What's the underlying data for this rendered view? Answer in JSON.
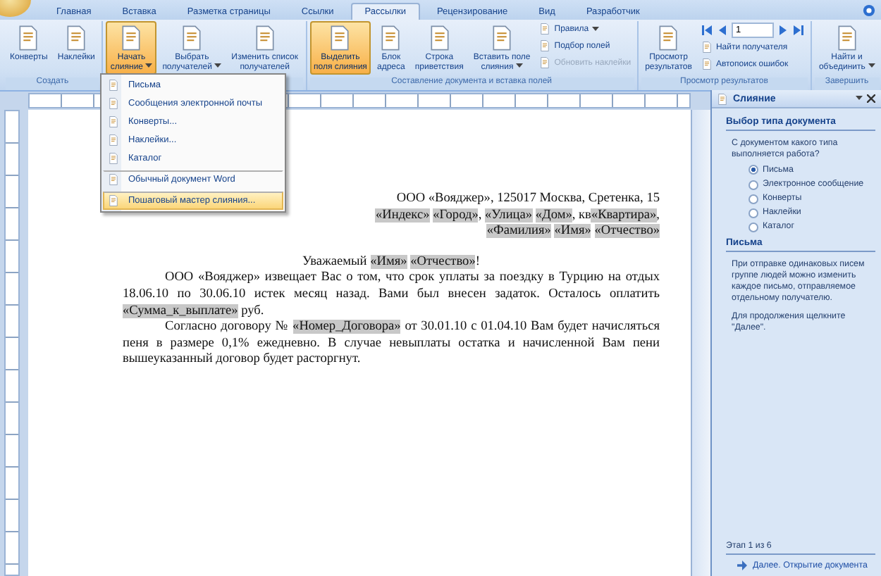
{
  "tabs": [
    {
      "label": "Главная",
      "selected": false
    },
    {
      "label": "Вставка",
      "selected": false
    },
    {
      "label": "Разметка страницы",
      "selected": false
    },
    {
      "label": "Ссылки",
      "selected": false
    },
    {
      "label": "Рассылки",
      "selected": true
    },
    {
      "label": "Рецензирование",
      "selected": false
    },
    {
      "label": "Вид",
      "selected": false
    },
    {
      "label": "Разработчик",
      "selected": false
    }
  ],
  "ribbon": {
    "groups": [
      {
        "label": "Создать",
        "columns": [
          [
            {
              "kind": "large",
              "label": "Конверты",
              "active": false,
              "disabled": false,
              "dropdown": false
            }
          ],
          [
            {
              "kind": "large",
              "label": "Наклейки",
              "active": false,
              "disabled": false,
              "dropdown": false
            }
          ]
        ]
      },
      {
        "columns": [
          [
            {
              "kind": "large",
              "label": "Начать\nслияние",
              "active": true,
              "disabled": false,
              "dropdown": true
            }
          ],
          [
            {
              "kind": "large",
              "label": "Выбрать\nполучателей",
              "active": false,
              "disabled": false,
              "dropdown": true
            }
          ],
          [
            {
              "kind": "large",
              "label": "Изменить список\nполучателей",
              "active": false,
              "disabled": false,
              "dropdown": false
            }
          ]
        ]
      },
      {
        "label": "Составление документа и вставка полей",
        "columns": [
          [
            {
              "kind": "large",
              "label": "Выделить\nполя слияния",
              "active": true,
              "disabled": false,
              "dropdown": false
            }
          ],
          [
            {
              "kind": "large",
              "label": "Блок\nадреса",
              "active": false,
              "disabled": false,
              "dropdown": false
            }
          ],
          [
            {
              "kind": "large",
              "label": "Строка\nприветствия",
              "active": false,
              "disabled": false,
              "dropdown": false
            }
          ],
          [
            {
              "kind": "large",
              "label": "Вставить поле\nслияния",
              "active": false,
              "disabled": false,
              "dropdown": true
            }
          ],
          [
            {
              "kind": "small",
              "label": "Правила",
              "active": false,
              "disabled": false,
              "dropdown": true
            },
            {
              "kind": "small",
              "label": "Подбор полей",
              "active": false,
              "disabled": false,
              "dropdown": false
            },
            {
              "kind": "small",
              "label": "Обновить наклейки",
              "active": false,
              "disabled": true,
              "dropdown": false
            }
          ]
        ]
      },
      {
        "label": "Просмотр результатов",
        "columns": [
          [
            {
              "kind": "large",
              "label": "Просмотр\nрезультатов",
              "active": false,
              "disabled": false,
              "dropdown": false
            }
          ],
          [
            {
              "kind": "nav",
              "value": "1"
            },
            {
              "kind": "small",
              "label": "Найти получателя",
              "active": false,
              "disabled": false,
              "dropdown": false
            },
            {
              "kind": "small",
              "label": "Автопоиск ошибок",
              "active": false,
              "disabled": false,
              "dropdown": false
            }
          ]
        ]
      },
      {
        "label": "Завершить",
        "columns": [
          [
            {
              "kind": "large",
              "label": "Найти и\nобъединить",
              "active": false,
              "disabled": false,
              "dropdown": true
            }
          ]
        ]
      }
    ]
  },
  "menu": {
    "items": [
      {
        "label": "Письма",
        "selected": false,
        "separator_before": false
      },
      {
        "label": "Сообщения электронной почты",
        "selected": false,
        "separator_before": false
      },
      {
        "label": "Конверты...",
        "selected": false,
        "separator_before": false
      },
      {
        "label": "Наклейки...",
        "selected": false,
        "separator_before": false
      },
      {
        "label": "Каталог",
        "selected": false,
        "separator_before": false
      },
      {
        "label": "Обычный документ Word",
        "selected": false,
        "separator_before": true
      },
      {
        "label": "Пошаговый мастер слияния...",
        "selected": true,
        "separator_before": true
      }
    ]
  },
  "document": {
    "address_lines": [
      [
        {
          "text": "ООО «Вояджер», 125017 Москва, Сретенка, 15",
          "field": false
        }
      ],
      [
        {
          "text": "«Индекс»",
          "field": true
        },
        {
          "text": "«Город»",
          "field": true
        },
        {
          "text": ", ",
          "field": false
        },
        {
          "text": "«Улица»",
          "field": true
        },
        {
          "text": "«Дом»",
          "field": true
        },
        {
          "text": ", кв",
          "field": false
        },
        {
          "text": "«Квартира»",
          "field": true
        },
        {
          "text": ",",
          "field": false
        }
      ],
      [
        {
          "text": "«Фамилия»",
          "field": true
        },
        {
          "text": "«Имя»",
          "field": true
        },
        {
          "text": "«Отчество»",
          "field": true
        }
      ]
    ],
    "greeting": [
      {
        "text": "Уважаемый ",
        "field": false
      },
      {
        "text": "«Имя»",
        "field": true
      },
      {
        "text": "«Отчество»",
        "field": true
      },
      {
        "text": "!",
        "field": false
      }
    ],
    "paragraphs": [
      [
        {
          "text": "ООО «Вояджер» извещает Вас о том, что срок уплаты за поездку в Турцию на отдых 18.06.10 по 30.06.10 истек месяц назад. Вами был внесен задаток. Осталось оплатить ",
          "field": false
        },
        {
          "text": "«Сумма_к_выплате»",
          "field": true
        },
        {
          "text": " руб.",
          "field": false
        }
      ],
      [
        {
          "text": "Согласно договору № ",
          "field": false
        },
        {
          "text": "«Номер_Договора»",
          "field": true
        },
        {
          "text": " от 30.01.10 с 01.04.10 Вам будет начисляться пеня в размере 0,1% ежедневно. В случае невыплаты остатка и начисленной Вам пени вышеуказанный договор будет расторгнут.",
          "field": false
        }
      ]
    ]
  },
  "task_pane": {
    "title": "Слияние",
    "heading": "Выбор типа документа",
    "question": "С документом какого типа выполняется работа?",
    "options": [
      {
        "label": "Письма",
        "selected": true
      },
      {
        "label": "Электронное сообщение",
        "selected": false
      },
      {
        "label": "Конверты",
        "selected": false
      },
      {
        "label": "Наклейки",
        "selected": false
      },
      {
        "label": "Каталог",
        "selected": false
      }
    ],
    "section_heading": "Письма",
    "description": "При отправке одинаковых писем группе людей можно изменить каждое письмо, отправляемое отдельному получателю.",
    "hint": "Для продолжения щелкните \"Далее\".",
    "step": "Этап 1 из 6",
    "next_link": "Далее. Открытие документа"
  }
}
